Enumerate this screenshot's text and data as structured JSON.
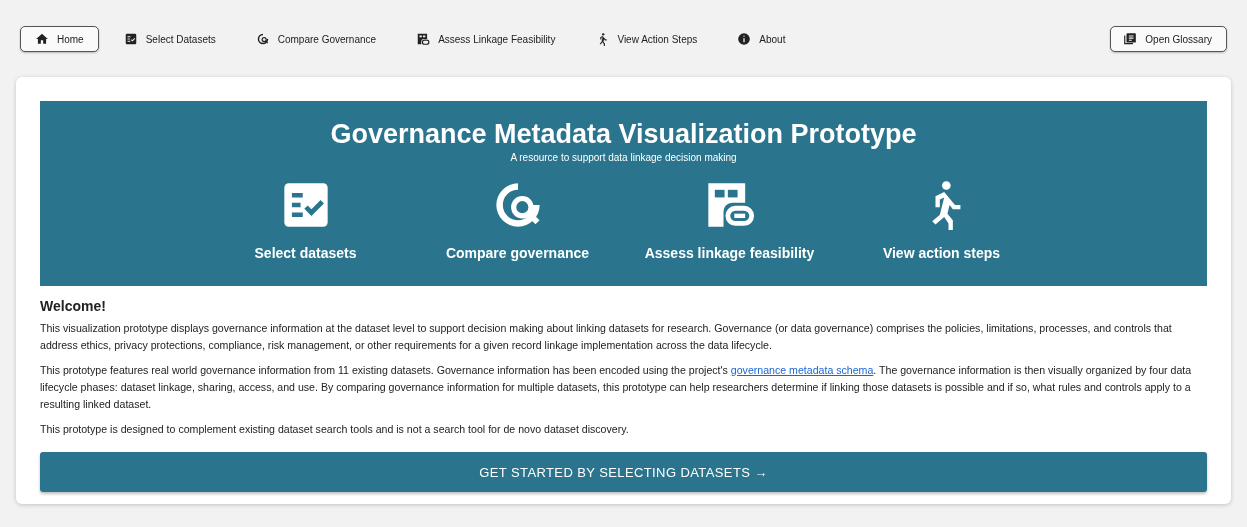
{
  "nav": {
    "items": [
      {
        "label": "Home",
        "kind": "home",
        "selected": true
      },
      {
        "label": "Select Datasets",
        "kind": "checklist",
        "selected": false
      },
      {
        "label": "Compare Governance",
        "kind": "globe-search",
        "selected": false
      },
      {
        "label": "Assess Linkage Feasibility",
        "kind": "link-grid",
        "selected": false
      },
      {
        "label": "View Action Steps",
        "kind": "walker",
        "selected": false
      },
      {
        "label": "About",
        "kind": "info",
        "selected": false
      }
    ],
    "glossary": "Open Glossary"
  },
  "banner": {
    "title": "Governance Metadata Visualization Prototype",
    "subtitle": "A resource to support data linkage decision making",
    "features": [
      {
        "label": "Select datasets",
        "kind": "checklist"
      },
      {
        "label": "Compare governance",
        "kind": "globe-search"
      },
      {
        "label": "Assess linkage feasibility",
        "kind": "link-grid"
      },
      {
        "label": "View action steps",
        "kind": "walker"
      }
    ]
  },
  "welcome": {
    "heading": "Welcome!",
    "paragraph_1": "This visualization prototype displays governance information at the dataset level to support decision making about linking datasets for research. Governance (or data governance) comprises the policies, limitations, processes, and controls that address ethics, privacy protections, compliance, risk management, or other requirements for a given record linkage implementation across the data lifecycle.",
    "paragraph_2": {
      "before": "This prototype features real world governance information from 11 existing datasets. Governance information has been encoded using the project's ",
      "link": "governance metadata schema",
      "after": ". The governance information is then visually organized by four data lifecycle phases: dataset linkage, sharing, access, and use. By comparing governance information for multiple datasets, this prototype can help researchers determine if linking those datasets is possible and if so, what rules and controls apply to a resulting linked dataset."
    },
    "paragraph_3": "This prototype is designed to complement existing dataset search tools and is not a search tool for de novo dataset discovery."
  },
  "cta": "GET STARTED BY SELECTING DATASETS →"
}
